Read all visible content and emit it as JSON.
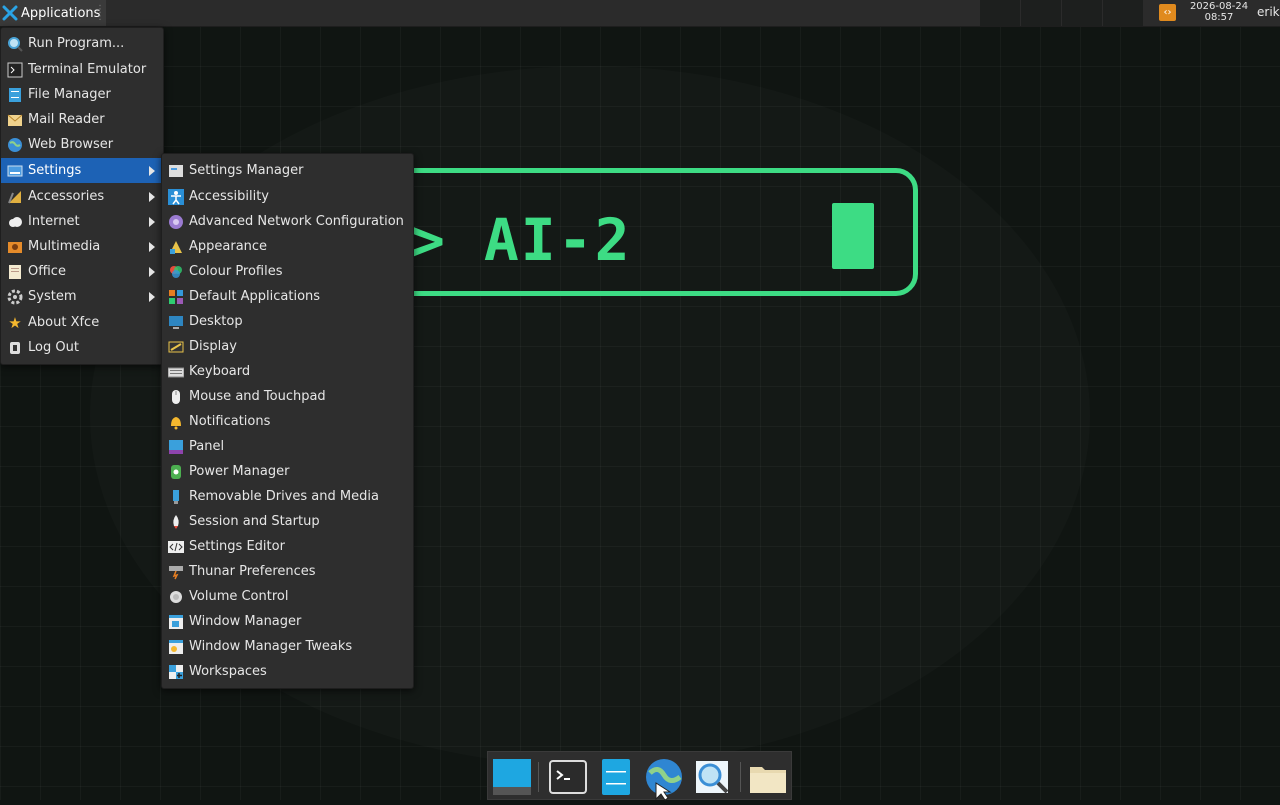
{
  "panel": {
    "apps_label": "Applications",
    "date": "2026-08-24",
    "time": "08:57",
    "user": "erik"
  },
  "desktop": {
    "banner_text": "> AI-2",
    "accent": "#3ddc84"
  },
  "main_menu": {
    "items": [
      {
        "label": "Run Program...",
        "icon": "search-icon"
      },
      {
        "label": "Terminal Emulator",
        "icon": "terminal-icon"
      },
      {
        "label": "File Manager",
        "icon": "file-manager-icon"
      },
      {
        "label": "Mail Reader",
        "icon": "mail-icon"
      },
      {
        "label": "Web Browser",
        "icon": "globe-icon"
      },
      {
        "label": "Settings",
        "icon": "settings-icon",
        "submenu": true,
        "active": true
      },
      {
        "label": "Accessories",
        "icon": "accessories-icon",
        "submenu": true
      },
      {
        "label": "Internet",
        "icon": "cloud-icon",
        "submenu": true
      },
      {
        "label": "Multimedia",
        "icon": "multimedia-icon",
        "submenu": true
      },
      {
        "label": "Office",
        "icon": "office-icon",
        "submenu": true
      },
      {
        "label": "System",
        "icon": "gear-icon",
        "submenu": true
      },
      {
        "label": "About Xfce",
        "icon": "star-icon"
      },
      {
        "label": "Log Out",
        "icon": "logout-icon"
      }
    ]
  },
  "settings_menu": {
    "items": [
      {
        "label": "Settings Manager",
        "icon": "settings-manager-icon"
      },
      {
        "label": "Accessibility",
        "icon": "accessibility-icon"
      },
      {
        "label": "Advanced Network Configuration",
        "icon": "network-icon"
      },
      {
        "label": "Appearance",
        "icon": "appearance-icon"
      },
      {
        "label": "Colour Profiles",
        "icon": "colour-profiles-icon"
      },
      {
        "label": "Default Applications",
        "icon": "default-apps-icon"
      },
      {
        "label": "Desktop",
        "icon": "desktop-icon"
      },
      {
        "label": "Display",
        "icon": "display-icon"
      },
      {
        "label": "Keyboard",
        "icon": "keyboard-icon"
      },
      {
        "label": "Mouse and Touchpad",
        "icon": "mouse-icon"
      },
      {
        "label": "Notifications",
        "icon": "bell-icon"
      },
      {
        "label": "Panel",
        "icon": "panel-icon"
      },
      {
        "label": "Power Manager",
        "icon": "power-icon"
      },
      {
        "label": "Removable Drives and Media",
        "icon": "usb-icon"
      },
      {
        "label": "Session and Startup",
        "icon": "rocket-icon"
      },
      {
        "label": "Settings Editor",
        "icon": "code-icon"
      },
      {
        "label": "Thunar Preferences",
        "icon": "thunar-icon"
      },
      {
        "label": "Volume Control",
        "icon": "volume-icon"
      },
      {
        "label": "Window Manager",
        "icon": "window-manager-icon"
      },
      {
        "label": "Window Manager Tweaks",
        "icon": "wm-tweaks-icon"
      },
      {
        "label": "Workspaces",
        "icon": "workspaces-icon"
      }
    ]
  },
  "dock": {
    "items": [
      {
        "icon": "show-desktop-icon"
      },
      {
        "icon": "terminal-icon"
      },
      {
        "icon": "file-manager-icon"
      },
      {
        "icon": "web-browser-icon"
      },
      {
        "icon": "app-finder-icon"
      },
      {
        "icon": "folder-icon"
      }
    ]
  }
}
